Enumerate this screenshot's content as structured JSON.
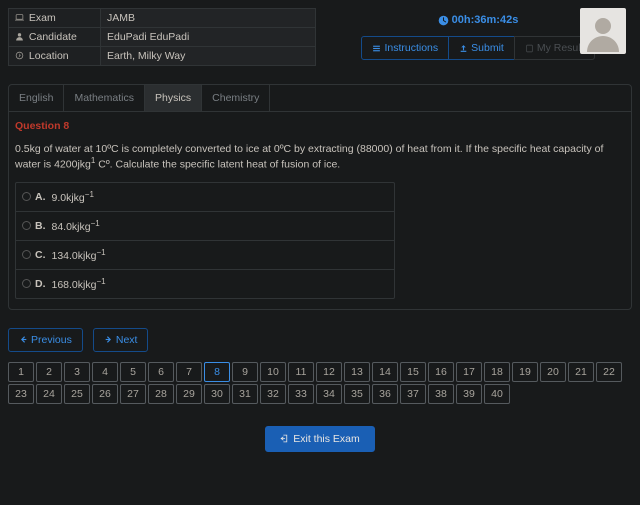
{
  "info": {
    "exam_label": "Exam",
    "exam_value": "JAMB",
    "candidate_label": "Candidate",
    "candidate_value": "EduPadi EduPadi",
    "location_label": "Location",
    "location_value": "Earth, Milky Way"
  },
  "timer": "00h:36m:42s",
  "buttons": {
    "instructions": "Instructions",
    "submit": "Submit",
    "my_result": "My Result",
    "previous": "Previous",
    "next": "Next",
    "exit": "Exit this Exam"
  },
  "tabs": [
    "English",
    "Mathematics",
    "Physics",
    "Chemistry"
  ],
  "active_tab": 2,
  "question": {
    "label": "Question 8",
    "text_pre": "0.5kg of water at 10ºC is completely converted to ice at 0ºC by extracting (88000) of heat from it. If the specific heat capacity of water is 4200jkg",
    "text_sup": "1",
    "text_post": " Cº. Calculate the specific latent heat of fusion of ice.",
    "options": [
      {
        "letter": "A.",
        "value": "9.0kjkg",
        "sup": "−1"
      },
      {
        "letter": "B.",
        "value": "84.0kjkg",
        "sup": "−1"
      },
      {
        "letter": "C.",
        "value": "134.0kjkg",
        "sup": "−1"
      },
      {
        "letter": "D.",
        "value": "168.0kjkg",
        "sup": "−1"
      }
    ]
  },
  "current_question": 8,
  "total_questions": 40
}
